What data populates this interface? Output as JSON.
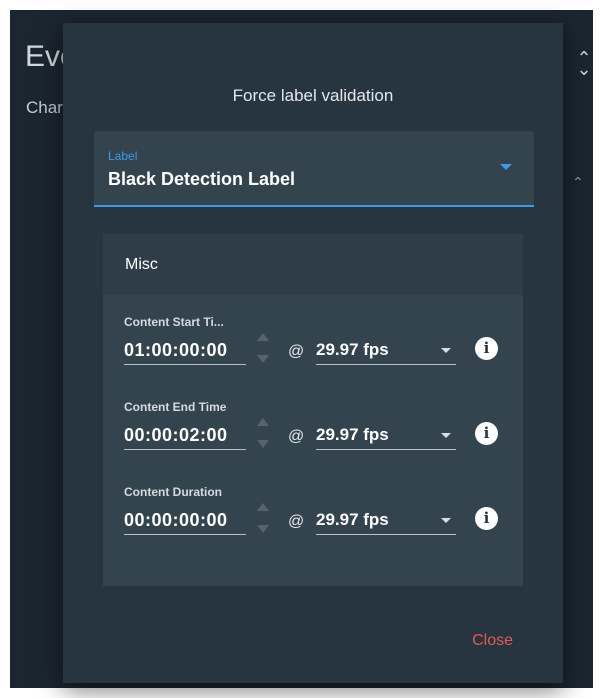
{
  "background": {
    "title": "Eve",
    "subtitle": "Char",
    "icons": [
      "collapse-icon",
      "chevron-up-icon"
    ]
  },
  "dialog": {
    "title": "Force label validation",
    "label_select": {
      "float_label": "Label",
      "value": "Black Detection Label"
    },
    "misc": {
      "header": "Misc",
      "rows": [
        {
          "label": "Content Start Ti...",
          "timecode": "01:00:00:00",
          "at": "@",
          "fps": "29.97 fps"
        },
        {
          "label": "Content End Time",
          "timecode": "00:00:02:00",
          "at": "@",
          "fps": "29.97 fps"
        },
        {
          "label": "Content Duration",
          "timecode": "00:00:00:00",
          "at": "@",
          "fps": "29.97 fps"
        }
      ]
    },
    "close_label": "Close"
  },
  "colors": {
    "dialog_bg": "#263540",
    "panel_bg": "#34444f",
    "accent": "#3b9be6",
    "danger": "#e25a4f"
  }
}
